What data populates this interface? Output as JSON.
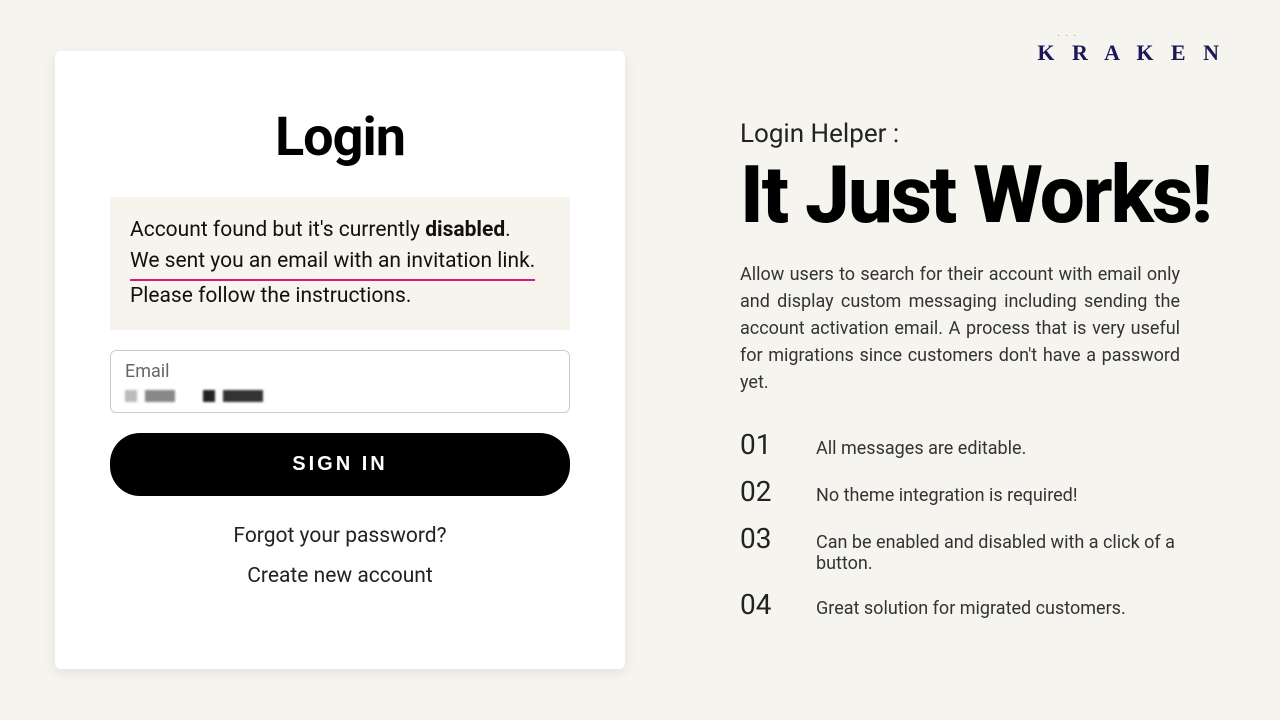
{
  "brand": "K R A K E N",
  "login": {
    "title": "Login",
    "alert": {
      "prefix": "Account found but it's currently ",
      "bold": "disabled",
      "suffix": ". ",
      "highlighted": "We sent you an email with an invitation link.",
      "rest": " Please follow the instructions."
    },
    "email_label": "Email",
    "signin_button": "SIGN IN",
    "forgot_link": "Forgot your password?",
    "create_link": "Create new account"
  },
  "marketing": {
    "eyebrow": "Login Helper :",
    "headline": "It Just Works!",
    "description": "Allow users to search for their account with email only and display custom messaging including sending the account activation email. A process that is very useful for migrations since customers don't have a password yet.",
    "features": [
      {
        "num": "01",
        "text": "All messages are editable."
      },
      {
        "num": "02",
        "text": "No theme integration is required!"
      },
      {
        "num": "03",
        "text": "Can be enabled and disabled with a click of a button."
      },
      {
        "num": "04",
        "text": "Great solution for migrated customers."
      }
    ]
  }
}
